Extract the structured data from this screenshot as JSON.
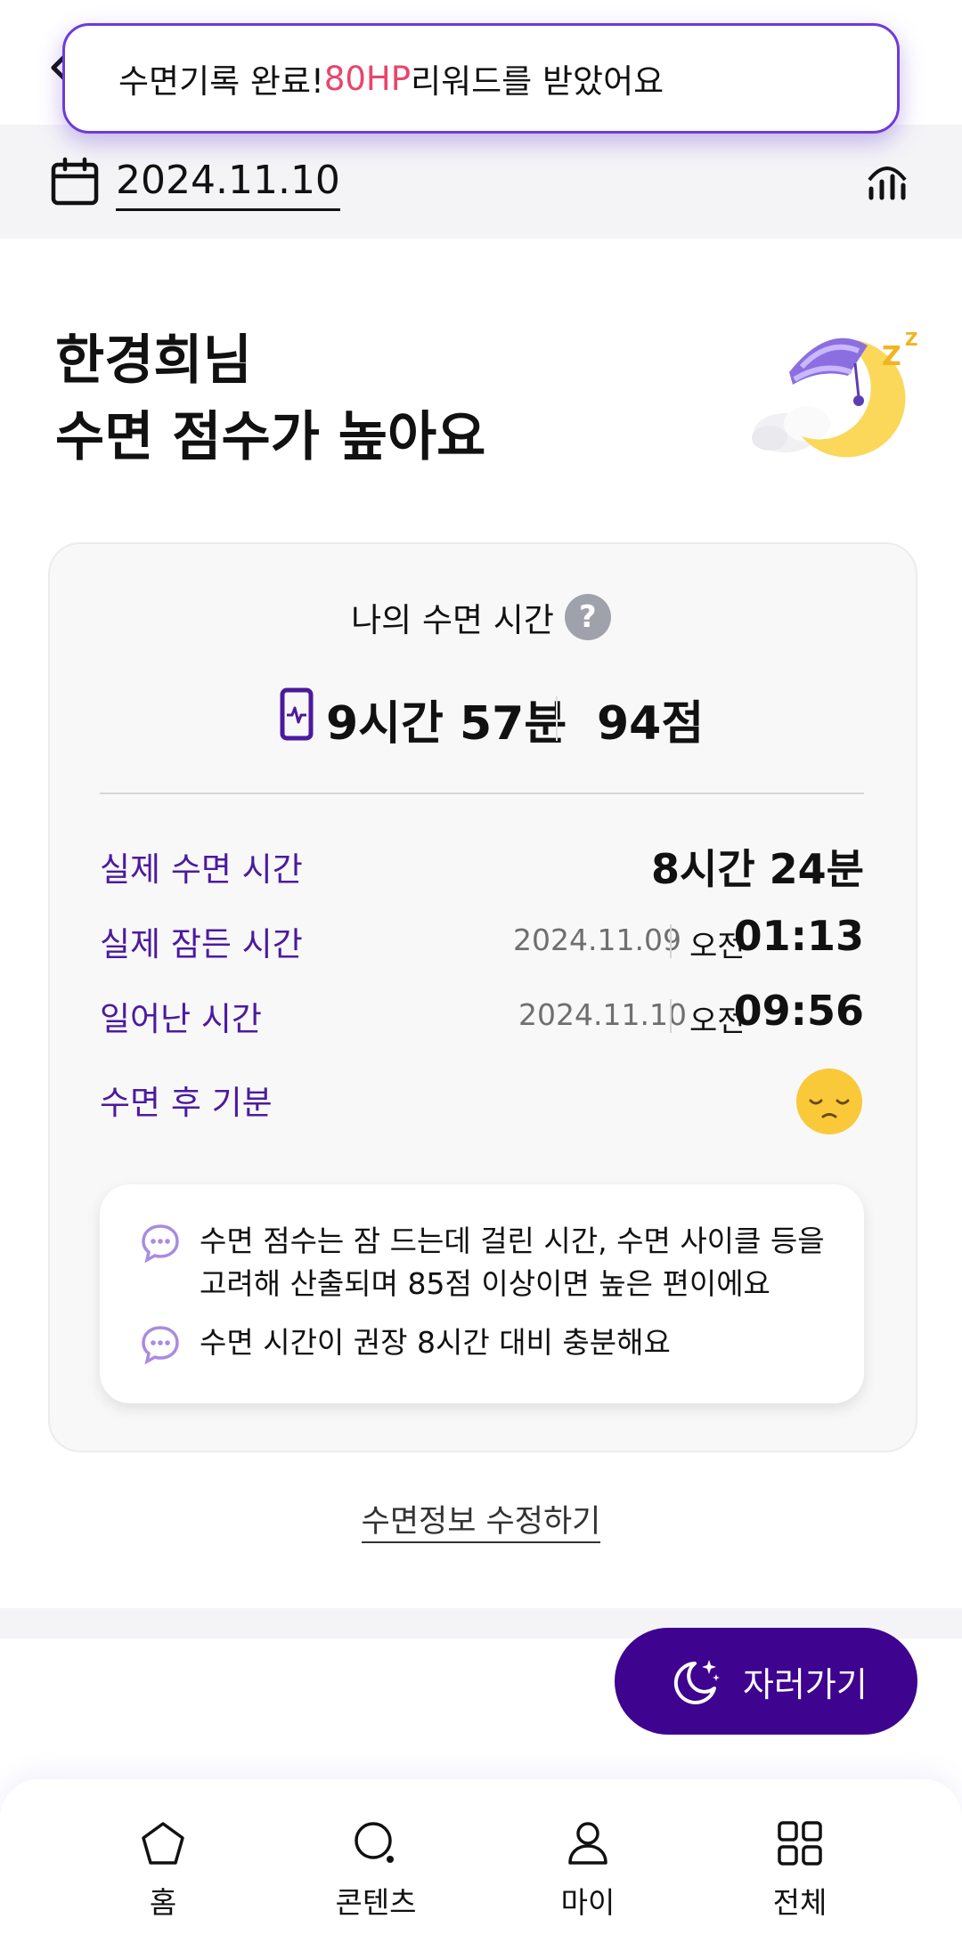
{
  "toast": {
    "prefix": "수면기록 완료! ",
    "highlight": "80HP",
    "suffix": " 리워드를 받았어요",
    "highlight_color": "#e9456b"
  },
  "datebar": {
    "date": "2024.11.10",
    "calendar_icon": "calendar-icon",
    "chart_icon": "bar-chart-icon"
  },
  "greeting": {
    "line1": "한경희님",
    "line2": "수면 점수가 높아요"
  },
  "summary": {
    "title": "나의 수면 시간",
    "help_symbol": "?",
    "duration": "9시간 57분",
    "score": "94점"
  },
  "details": {
    "actual_sleep": {
      "label": "실제 수면 시간",
      "value": "8시간 24분"
    },
    "fell_asleep": {
      "label": "실제 잠든 시간",
      "date": "2024.11.09",
      "ampm": "오전",
      "time": "01:13"
    },
    "woke_up": {
      "label": "일어난 시간",
      "date": "2024.11.10",
      "ampm": "오전",
      "time": "09:56"
    },
    "mood": {
      "label": "수면 후 기분",
      "icon": "sleepy-face-icon"
    }
  },
  "tips": {
    "tip1_line1": "수면 점수는 잠 드는데 걸린 시간, 수면 사이클 등을",
    "tip1_line2": "고려해 산출되며 85점 이상이면 높은 편이에요",
    "tip2": "수면 시간이 권장 8시간 대비 충분해요"
  },
  "edit_link": "수면정보 수정하기",
  "sleep_button": "자러가기",
  "tabs": [
    {
      "label": "홈",
      "icon": "home-icon"
    },
    {
      "label": "콘텐츠",
      "icon": "search-icon"
    },
    {
      "label": "마이",
      "icon": "user-icon"
    },
    {
      "label": "전체",
      "icon": "grid-icon"
    }
  ],
  "colors": {
    "accent": "#3e038f",
    "label_purple": "#4b1a9e",
    "toast_border": "#6c3cd9"
  }
}
